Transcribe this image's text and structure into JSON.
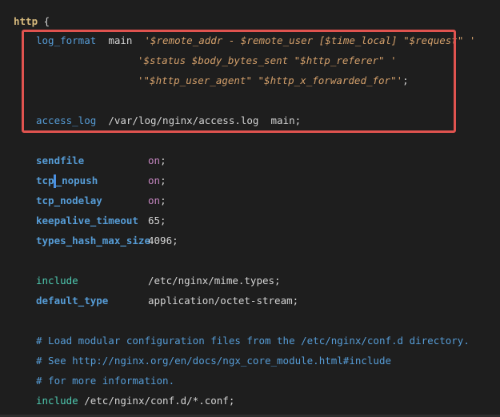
{
  "editor": {
    "language": "nginx",
    "highlight_color": "#e0534f",
    "lines": {
      "http_open": {
        "keyword": "http",
        "brace": " {"
      },
      "log_format_1": {
        "directive": "log_format",
        "name": "  main  ",
        "value": "'$remote_addr - $remote_user [$time_local] \"$request\" '"
      },
      "log_format_2": {
        "value": "'$status $body_bytes_sent \"$http_referer\" '"
      },
      "log_format_3": {
        "value": "'\"$http_user_agent\" \"$http_x_forwarded_for\"'",
        "end": ";"
      },
      "access_log": {
        "directive": "access_log",
        "value": "  /var/log/nginx/access.log  main;"
      },
      "sendfile": {
        "directive": "sendfile",
        "value": "on",
        "end": ";"
      },
      "tcp_nopush": {
        "directive_a": "tcp",
        "directive_b": "nopush",
        "value": "on",
        "end": ";"
      },
      "tcp_nodelay": {
        "directive": "tcp_nodelay",
        "value": "on",
        "end": ";"
      },
      "keepalive_timeout": {
        "directive": "keepalive_timeout",
        "value": "65;"
      },
      "types_hash_max_size": {
        "directive": "types_hash_max_size",
        "value": "4096;"
      },
      "include_1": {
        "directive": "include",
        "value": "/etc/nginx/mime.types;"
      },
      "default_type": {
        "directive": "default_type",
        "value": "application/octet-stream;"
      },
      "comment_1": {
        "text": "# Load modular configuration files from the /etc/nginx/conf.d directory."
      },
      "comment_2": {
        "text": "# See http://nginx.org/en/docs/ngx_core_module.html#include"
      },
      "comment_3": {
        "text": "# for more information."
      },
      "include_2": {
        "directive": "include",
        "value": " /etc/nginx/conf.d/*.conf;"
      }
    }
  }
}
